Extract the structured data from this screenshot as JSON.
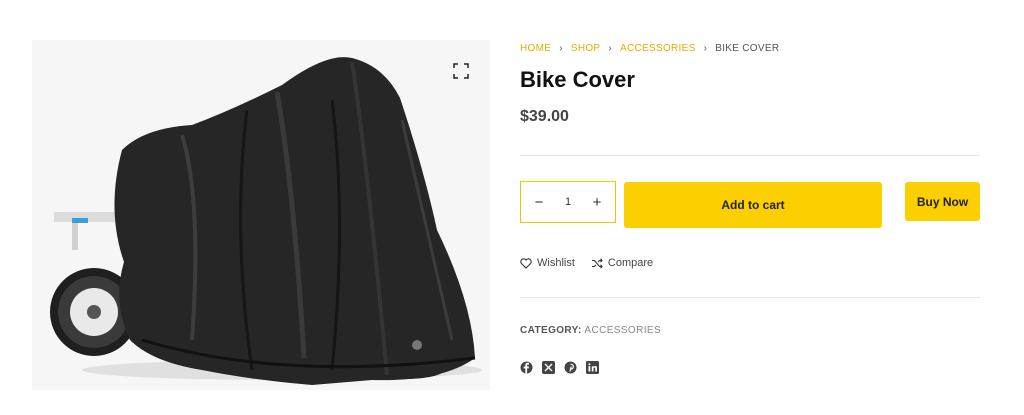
{
  "gallery": {
    "image_alt": "Bike Cover",
    "zoom_icon": "expand-icon"
  },
  "breadcrumb": {
    "items": [
      "Home",
      "Shop",
      "Accessories"
    ],
    "current": "Bike Cover",
    "separator": "›"
  },
  "product": {
    "title": "Bike Cover",
    "price": "$39.00"
  },
  "cart": {
    "quantity": "1",
    "minus_label": "−",
    "plus_label": "+",
    "add_to_cart_label": "Add to cart",
    "buy_now_label": "Buy Now"
  },
  "actions": {
    "wishlist_label": "Wishlist",
    "compare_label": "Compare"
  },
  "meta": {
    "category_label": "CATEGORY:",
    "category_value": "Accessories"
  },
  "social": [
    "facebook-icon",
    "x-twitter-icon",
    "pinterest-icon",
    "linkedin-icon"
  ],
  "colors": {
    "accent": "#fccf00",
    "breadcrumb_link": "#e5ad00",
    "text_dark": "#111111",
    "text_muted": "#888888"
  }
}
